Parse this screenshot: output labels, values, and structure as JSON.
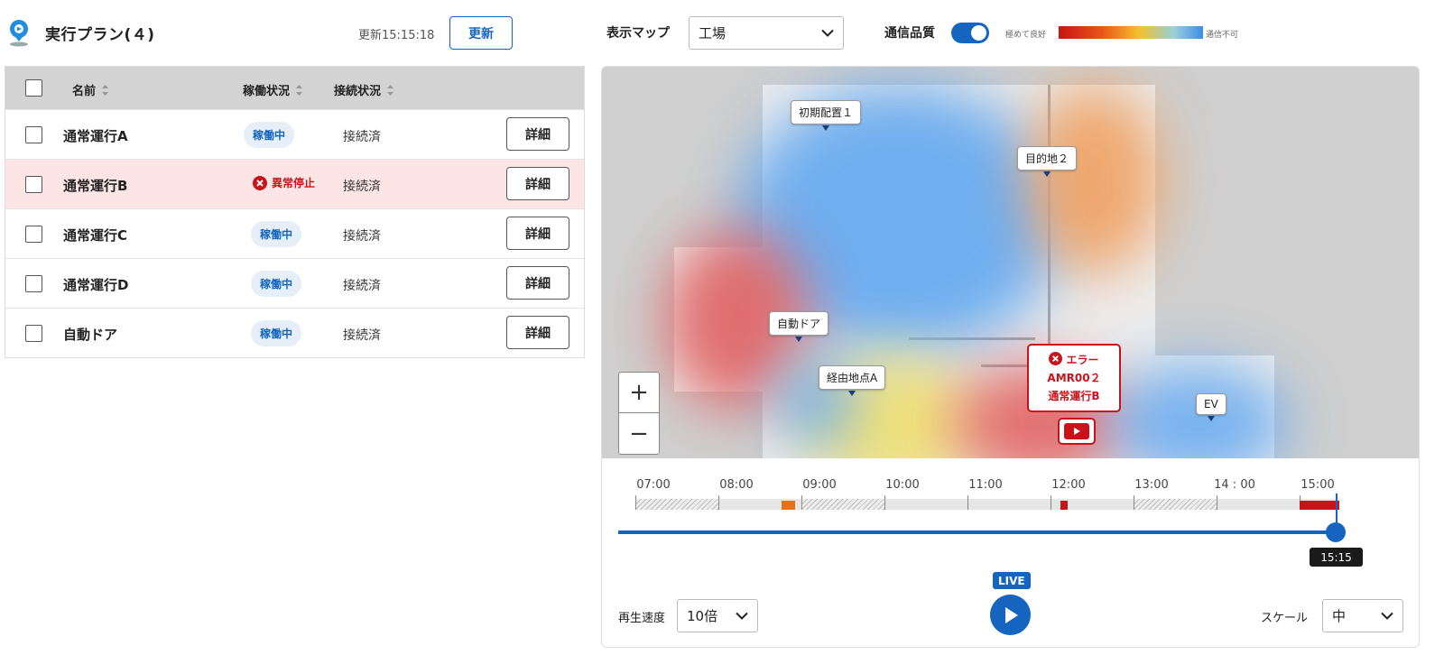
{
  "header": {
    "title": "実行プラン(４)",
    "updated": "更新15:15:18",
    "refresh_label": "更新",
    "map_label": "表示マップ",
    "map_value": "工場",
    "quality_label": "通信品質",
    "quality_enabled": true,
    "legend_good": "極めて良好",
    "legend_bad": "通信不可"
  },
  "table": {
    "columns": [
      "名前",
      "稼働状況",
      "接続状況"
    ],
    "rows": [
      {
        "name": "通常運行A",
        "status": "稼働中",
        "connection": "接続済",
        "detail": "詳細"
      },
      {
        "name": "通常運行B",
        "status": "異常停止",
        "connection": "接続済",
        "detail": "詳細"
      },
      {
        "name": "通常運行C",
        "status": "稼働中",
        "connection": "接続済",
        "detail": "詳細"
      },
      {
        "name": "通常運行D",
        "status": "稼働中",
        "connection": "接続済",
        "detail": "詳細"
      },
      {
        "name": "自動ドア",
        "status": "稼働中",
        "connection": "接続済",
        "detail": "詳細"
      }
    ]
  },
  "map": {
    "pins": [
      "初期配置１",
      "目的地２",
      "自動ドア",
      "経由地点A",
      "EV"
    ],
    "error": {
      "title": "エラー",
      "robot": "AMR00２",
      "plan": "通常運行B"
    },
    "zoom_in": "+",
    "zoom_out": "−"
  },
  "timeline": {
    "ticks": [
      "07:00",
      "08:00",
      "09:00",
      "10:00",
      "11:00",
      "12:00",
      "13:00",
      "14 : 00",
      "15:00"
    ],
    "current": "15:15",
    "speed_label": "再生速度",
    "speed_value": "10倍",
    "live": "LIVE",
    "scale_label": "スケール",
    "scale_value": "中"
  },
  "colors": {
    "accent": "#1565c0",
    "error": "#c8131b",
    "orange": "#e8701a"
  },
  "icons": [
    "app-logo-icon",
    "chevron-down-icon",
    "sort-icon",
    "error-circle-icon",
    "robot-camera-icon",
    "play-icon"
  ]
}
